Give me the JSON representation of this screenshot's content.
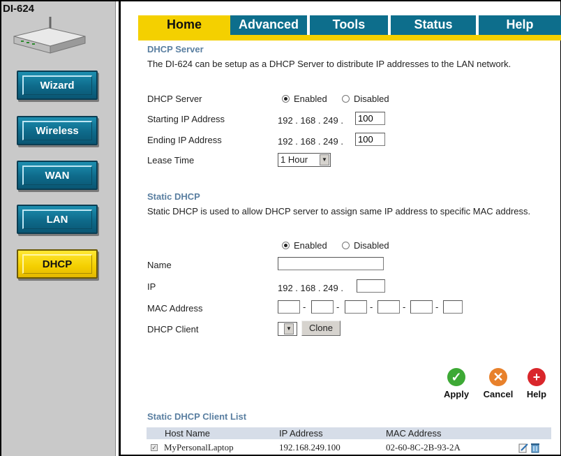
{
  "sidebar": {
    "model": "DI-624",
    "items": [
      {
        "label": "Wizard"
      },
      {
        "label": "Wireless"
      },
      {
        "label": "WAN"
      },
      {
        "label": "LAN"
      },
      {
        "label": "DHCP",
        "active": true
      }
    ]
  },
  "tabs": [
    "Home",
    "Advanced",
    "Tools",
    "Status",
    "Help"
  ],
  "dhcp_server": {
    "title": "DHCP Server",
    "description": "The DI-624 can be setup as a DHCP Server to distribute IP addresses to the LAN network.",
    "server_label": "DHCP Server",
    "enabled_label": "Enabled",
    "disabled_label": "Disabled",
    "selected": "Enabled",
    "start_label": "Starting IP Address",
    "start_prefix": "192 . 168 . 249 .",
    "start_value": "100",
    "end_label": "Ending IP Address",
    "end_prefix": "192 . 168 . 249 .",
    "end_value": "100",
    "lease_label": "Lease Time",
    "lease_value": "1 Hour"
  },
  "static_dhcp": {
    "title": "Static DHCP",
    "description": "Static DHCP is used to allow DHCP server to assign same IP address to specific MAC address.",
    "enabled_label": "Enabled",
    "disabled_label": "Disabled",
    "selected": "Enabled",
    "name_label": "Name",
    "name_value": "",
    "ip_label": "IP",
    "ip_prefix": "192 . 168 . 249 .",
    "ip_value": "",
    "mac_label": "MAC Address",
    "mac_separator": "-",
    "client_label": "DHCP Client",
    "clone_label": "Clone"
  },
  "actions": {
    "apply": "Apply",
    "cancel": "Cancel",
    "help": "Help",
    "apply_color": "#3da935",
    "cancel_color": "#e8812b",
    "help_color": "#d9262b"
  },
  "client_list": {
    "title": "Static DHCP Client List",
    "headers": [
      "Host Name",
      "IP Address",
      "MAC Address"
    ],
    "rows": [
      {
        "host": "MyPersonalLaptop",
        "ip": "192.168.249.100",
        "mac": "02-60-8C-2B-93-2A",
        "checked": true
      }
    ]
  }
}
